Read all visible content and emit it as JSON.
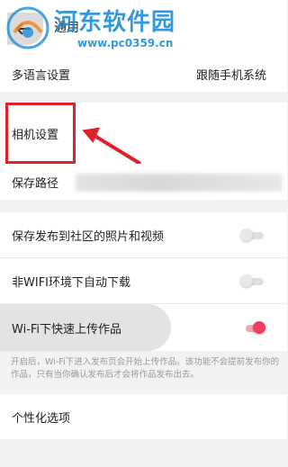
{
  "header": {
    "title": "通用",
    "back_icon": "back-arrow-icon",
    "watermark_title": "河东软件园",
    "watermark_url": "www.pc0359.cn"
  },
  "settings": {
    "language": {
      "label": "多语言设置",
      "value": "跟随手机系统"
    },
    "camera": {
      "label": "相机设置"
    },
    "save_path": {
      "label": "保存路径"
    },
    "save_posted": {
      "label": "保存发布到社区的照片和视频",
      "enabled": false
    },
    "non_wifi_download": {
      "label": "非WIFI环境下自动下载",
      "enabled": false
    },
    "wifi_upload": {
      "label": "Wi-Fi下快速上传作品",
      "enabled": true
    },
    "wifi_upload_note": "开启后，Wi-Fi下进入发布页会开始上传作品。该功能不会提前发布你的作品，只有当你确认发布后才会将作品发布出去。",
    "personalization": {
      "label": "个性化选项"
    }
  },
  "colors": {
    "annotation_red": "#e0202a",
    "toggle_on": "#f0405e",
    "watermark_blue": "#1f8fd6"
  }
}
